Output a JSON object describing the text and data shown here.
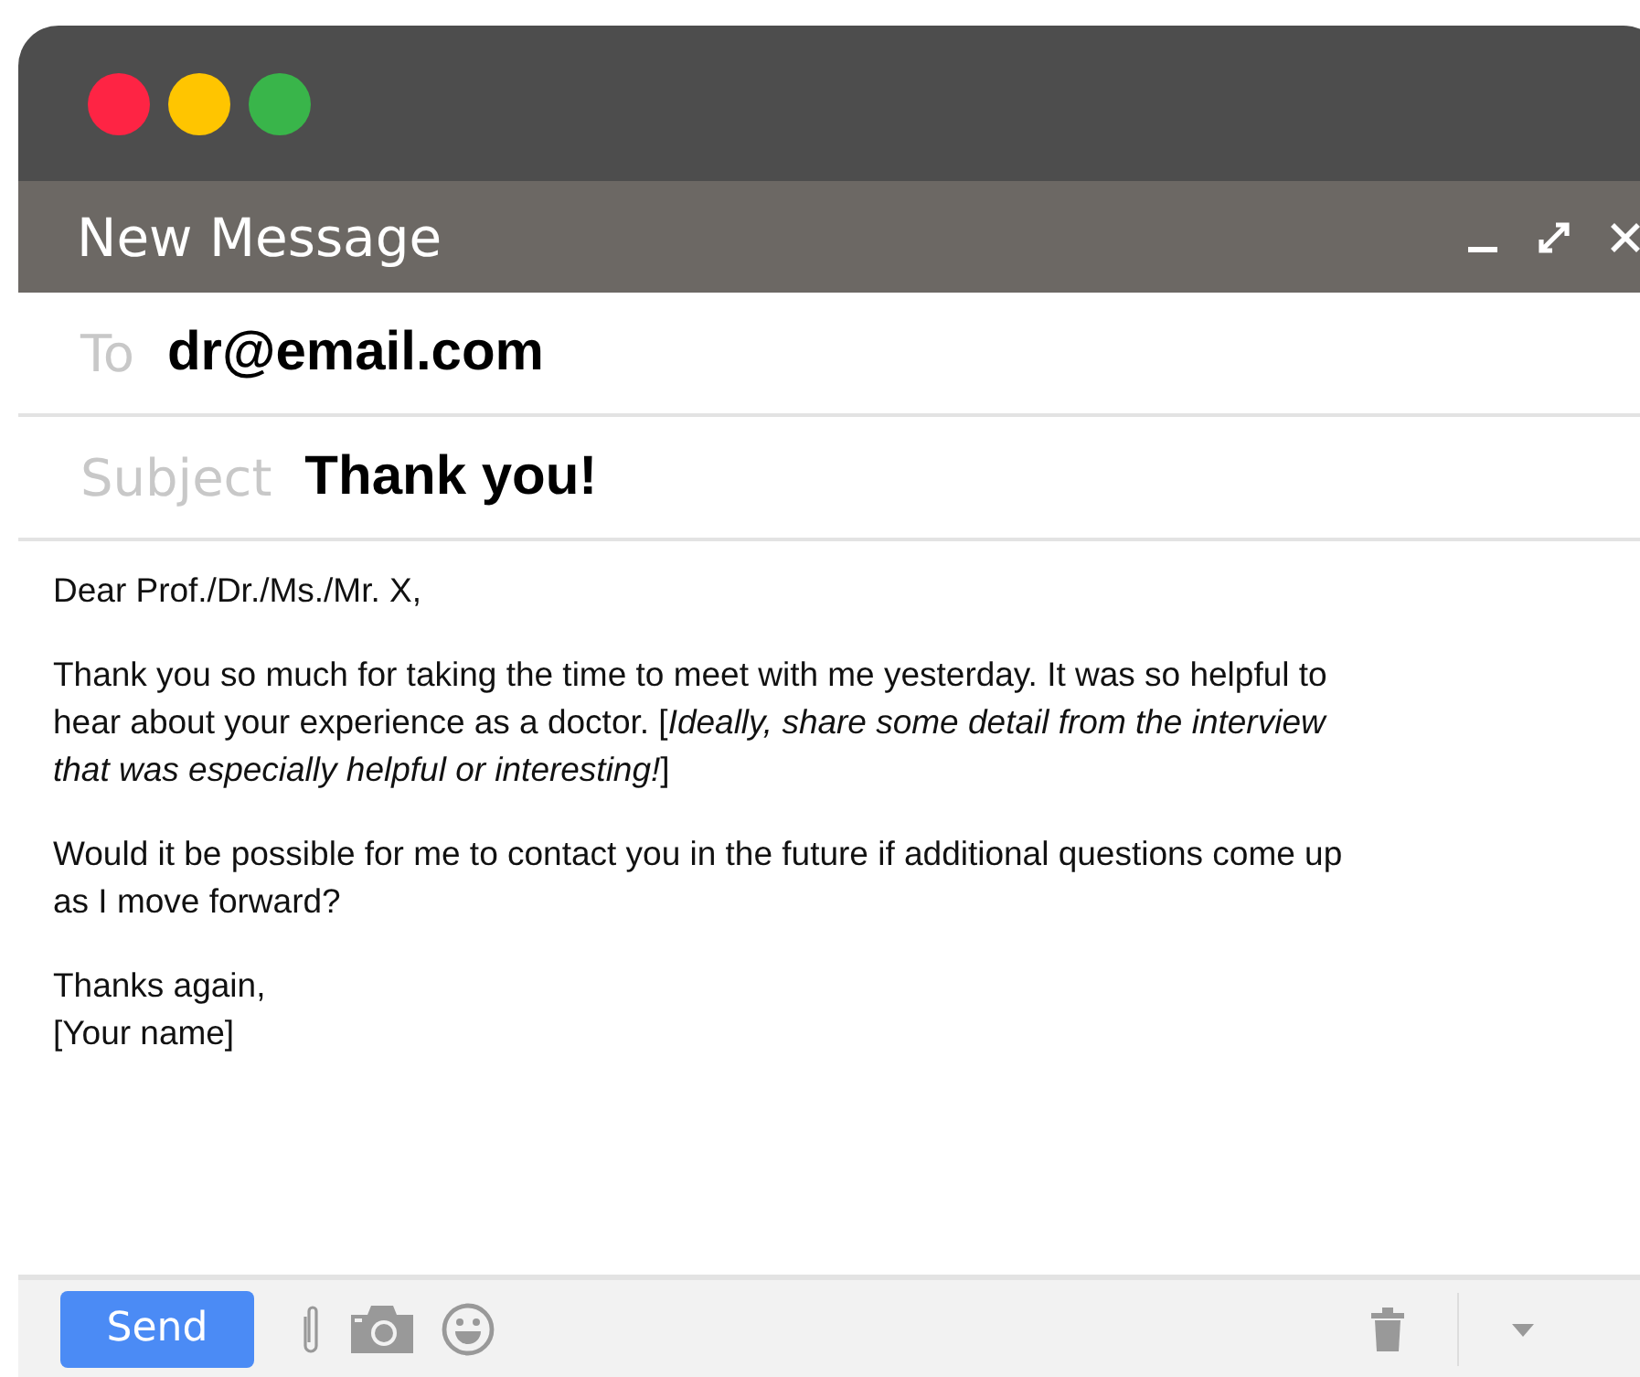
{
  "window": {
    "title": "New Message"
  },
  "to": {
    "label": "To",
    "value": "dr@email.com"
  },
  "subject": {
    "label": "Subject",
    "value": "Thank you!"
  },
  "body": [
    "Dear Prof./Dr./Ms./Mr. X,",
    "Thank you so much for taking the time to meet with me yesterday. It was so helpful to hear about your experience as a doctor. [*Ideally, share some detail from the interview that was especially helpful or interesting!*]",
    "Would it be possible for me to contact you in the future if additional questions come up as I move forward?",
    "Thanks again,\n[Your name]"
  ],
  "toolbar": {
    "send": "Send"
  }
}
